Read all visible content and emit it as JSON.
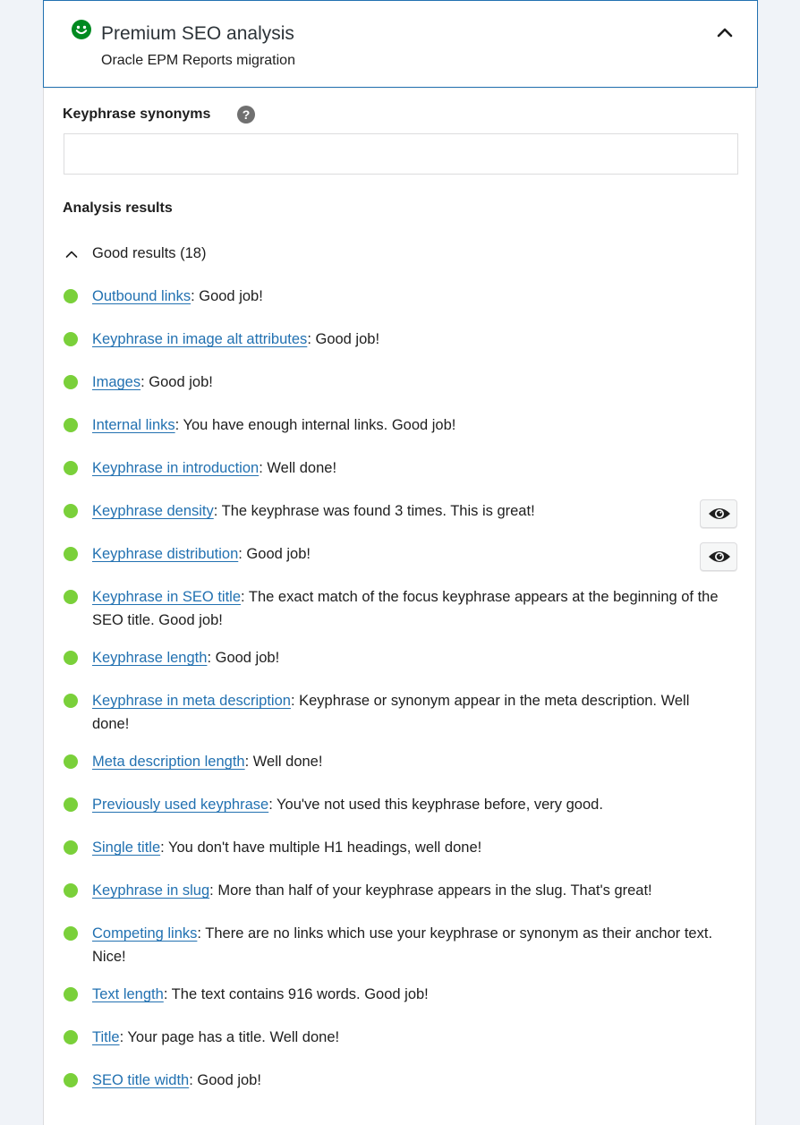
{
  "header": {
    "title": "Premium SEO analysis",
    "subtitle": "Oracle EPM Reports migration",
    "status_icon": "smiley-icon",
    "status_color": "#008a20",
    "toggle_icon": "chevron-up-icon"
  },
  "synonyms": {
    "label": "Keyphrase synonyms",
    "help_glyph": "?",
    "value": "",
    "placeholder": ""
  },
  "analysis": {
    "heading": "Analysis results",
    "good_group": {
      "label": "Good results (18)",
      "bullet_color": "#7ad03a",
      "items": [
        {
          "link": "Outbound links",
          "text": ": Good job!"
        },
        {
          "link": "Keyphrase in image alt attributes",
          "text": ": Good job!"
        },
        {
          "link": "Images",
          "text": ": Good job!"
        },
        {
          "link": "Internal links",
          "text": ": You have enough internal links. Good job!"
        },
        {
          "link": "Keyphrase in introduction",
          "text": ": Well done!"
        },
        {
          "link": "Keyphrase density",
          "text": ": The keyphrase was found 3 times. This is great!",
          "has_eye": true
        },
        {
          "link": "Keyphrase distribution",
          "text": ": Good job!",
          "has_eye": true
        },
        {
          "link": "Keyphrase in SEO title",
          "text": ": The exact match of the focus keyphrase appears at the beginning of the SEO title. Good job!"
        },
        {
          "link": "Keyphrase length",
          "text": ": Good job!"
        },
        {
          "link": "Keyphrase in meta description",
          "text": ": Keyphrase or synonym appear in the meta description. Well done!"
        },
        {
          "link": "Meta description length",
          "text": ": Well done!"
        },
        {
          "link": "Previously used keyphrase",
          "text": ": You've not used this keyphrase before, very good."
        },
        {
          "link": "Single title",
          "text": ": You don't have multiple H1 headings, well done!"
        },
        {
          "link": "Keyphrase in slug",
          "text": ": More than half of your keyphrase appears in the slug. That's great!"
        },
        {
          "link": "Competing links",
          "text": ": There are no links which use your keyphrase or synonym as their anchor text. Nice!"
        },
        {
          "link": "Text length",
          "text": ": The text contains 916 words. Good job!"
        },
        {
          "link": "Title",
          "text": ": Your page has a title. Well done!"
        },
        {
          "link": "SEO title width",
          "text": ": Good job!"
        }
      ]
    }
  },
  "colors": {
    "link": "#2271b1",
    "good": "#7ad03a",
    "border_active": "#2271b1"
  },
  "icons": {
    "eye": "eye-icon",
    "help": "help-icon",
    "group_toggle": "chevron-up-icon"
  }
}
